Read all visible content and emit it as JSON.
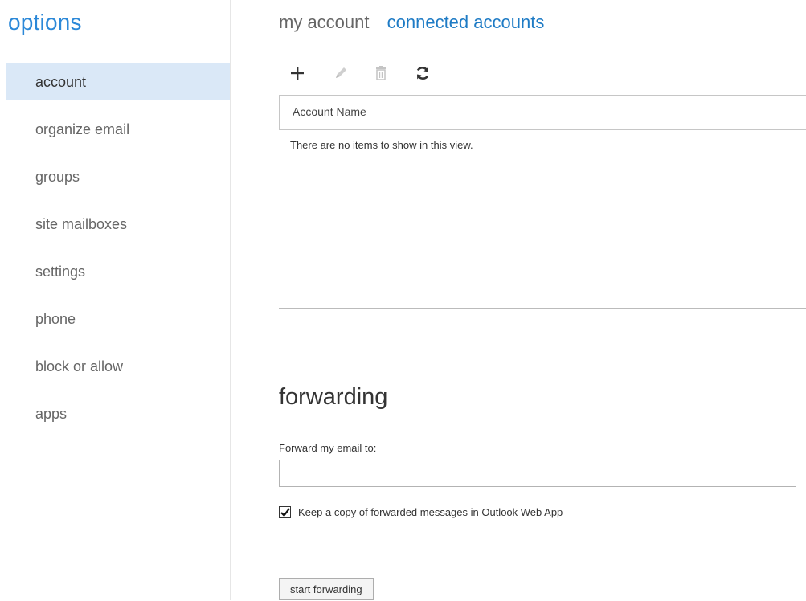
{
  "sidebar": {
    "title": "options",
    "items": [
      {
        "label": "account"
      },
      {
        "label": "organize email"
      },
      {
        "label": "groups"
      },
      {
        "label": "site mailboxes"
      },
      {
        "label": "settings"
      },
      {
        "label": "phone"
      },
      {
        "label": "block or allow"
      },
      {
        "label": "apps"
      }
    ],
    "selected": "account"
  },
  "tabs": [
    {
      "label": "my account"
    },
    {
      "label": "connected accounts"
    }
  ],
  "active_tab": "connected accounts",
  "toolbar": {
    "icons": [
      "plus-icon",
      "pencil-icon",
      "trash-icon",
      "refresh-icon"
    ]
  },
  "list": {
    "column_header": "Account Name",
    "empty_message": "There are no items to show in this view."
  },
  "forwarding": {
    "title": "forwarding",
    "field_label": "Forward my email to:",
    "field_value": "",
    "checkbox_label": "Keep a copy of forwarded messages in Outlook Web App",
    "checkbox_checked": true,
    "button_label": "start forwarding"
  },
  "colors": {
    "accent": "#2b88d8",
    "selected_bg": "#dae8f7"
  }
}
